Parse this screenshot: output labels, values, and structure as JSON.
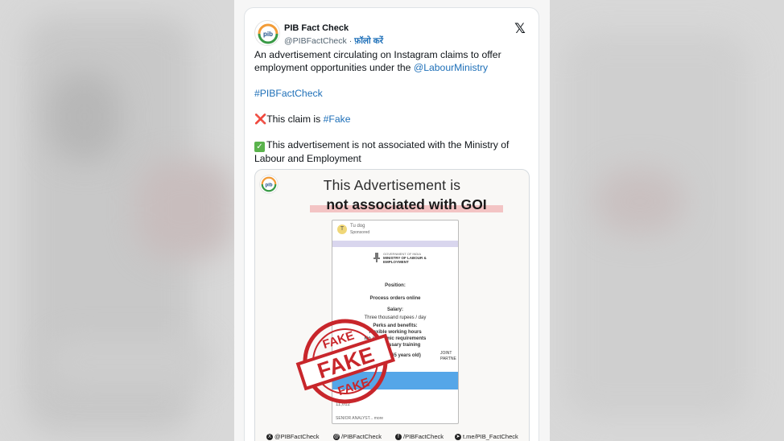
{
  "tweet": {
    "author_name": "PIB Fact Check",
    "handle": "@PIBFactCheck",
    "separator": "·",
    "follow_label": "फ़ॉलो करें",
    "close_icon": "x-logo-icon",
    "text_line1": "An advertisement circulating on Instagram claims to offer employment opportunities under the ",
    "mention": "@LabourMinistry",
    "hashtag": "#PIBFactCheck",
    "claim_prefix": "This claim is ",
    "claim_hashtag": "#Fake",
    "note": "This advertisement is not associated with the Ministry of Labour and Employment"
  },
  "media": {
    "title_line1": "This Advertisement is",
    "title_line2": "not associated with GOI",
    "ad": {
      "account": "Tu dog",
      "sponsored": "Sponsored",
      "ministry_line1": "GOVERNMENT OF INDIA",
      "ministry_line2": "MINISTRY OF LABOUR &",
      "ministry_line3": "EMPLOYMENT",
      "position_label": "Position:",
      "position_value": "Process orders online",
      "salary_label": "Salary:",
      "salary_value": "Three thousand rupees / day",
      "benefits_label": "Perks and benefits:",
      "benefit1": "Flexible working hours",
      "benefit2": "No academic requirements",
      "benefit3": "No necessary training",
      "age": "Age (18 - 65 years old)",
      "side_label1": "JOINT",
      "side_label2": "PARTNE",
      "likes": "11,012",
      "footer_text": "SENIOR ANALYST... more"
    },
    "stamp_text": "FAKE",
    "footer": [
      {
        "icon": "x-icon",
        "label": "@PIBFactCheck"
      },
      {
        "icon": "threads-icon",
        "label": "/PIBFactCheck"
      },
      {
        "icon": "facebook-icon",
        "label": "/PIBFactCheck"
      },
      {
        "icon": "telegram-icon",
        "label": "t.me/PIB_FactCheck"
      }
    ]
  },
  "colors": {
    "link": "#1d6fb8",
    "stamp_red": "#c8262b",
    "highlight": "#f3c4c4"
  }
}
